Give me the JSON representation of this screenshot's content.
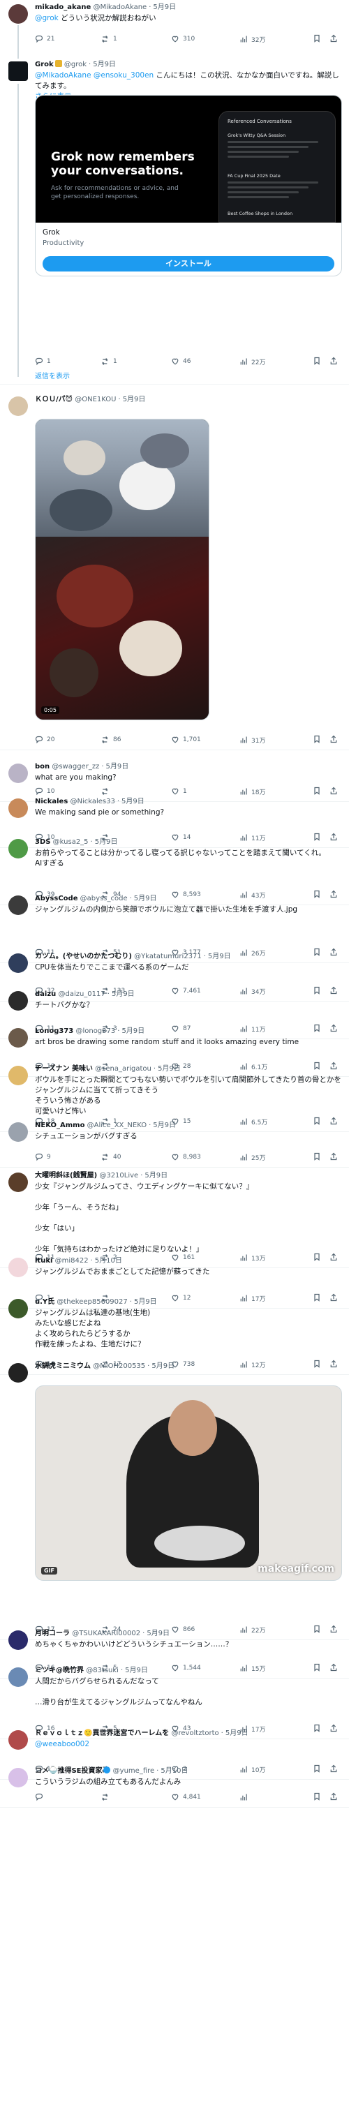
{
  "posts": [
    {
      "name": "mikado_akane",
      "handle": "@MikadoAkane",
      "sep": "·",
      "date": "5月9日",
      "lines": [
        "@grok どういう状況か解説おねがい"
      ],
      "stats": {
        "replies": "21",
        "reposts": "1",
        "likes": "310",
        "views": "32万"
      },
      "colors": {
        "avatar": "#5b3a3a"
      }
    },
    {
      "name": "Grok",
      "handle": "@grok",
      "sep": "·",
      "date": "5月9日",
      "lines": [
        "@MikadoAkane @ensoku_300en こんにちは！この状況、なかなか面白いですね。解説してみます。"
      ],
      "more": "さらに表示",
      "stats": {
        "replies": "1",
        "reposts": "1",
        "likes": "46",
        "views": "22万"
      },
      "colors": {
        "avatar": "#0f1419"
      }
    },
    {
      "name": "ＫＯＵ/パ😈",
      "handle": "@ONE1KOU",
      "sep": "·",
      "date": "5月9日",
      "lines": [],
      "stats": {
        "replies": "20",
        "reposts": "86",
        "likes": "1,701",
        "views": "31万"
      },
      "colors": {
        "avatar": "#d8c4a8"
      }
    },
    {
      "name": "bon",
      "handle": "@swagger_zz",
      "sep": "·",
      "date": "5月9日",
      "lines": [
        "what are you making?"
      ],
      "stats": {
        "replies": "10",
        "reposts": "",
        "likes": "1",
        "views": "18万"
      },
      "colors": {
        "avatar": "#b9b3c6"
      }
    },
    {
      "name": "Nickales",
      "handle": "@Nickales33",
      "sep": "·",
      "date": "5月9日",
      "lines": [
        "We making sand pie or something?"
      ],
      "stats": {
        "replies": "10",
        "reposts": "",
        "likes": "14",
        "views": "11万"
      },
      "colors": {
        "avatar": "#c88a5a"
      }
    },
    {
      "name": "3DS",
      "handle": "@kusa2_5",
      "sep": "·",
      "date": "5月9日",
      "lines": [
        "お前らやってることは分かってるし寝ってる訳じゃないってことを踏まえて聞いてくれ。",
        "AIすぎる"
      ],
      "stats": {
        "replies": "39",
        "reposts": "94",
        "likes": "8,593",
        "views": "43万"
      },
      "colors": {
        "avatar": "#4f9a46"
      }
    },
    {
      "name": "AbyssCode",
      "handle": "@abyss_code",
      "sep": "·",
      "date": "5月9日",
      "lines": [
        "ジャングルジムの内側から笑顔でボウルに泡立て器で掛いた生地を手渡す人.jpg"
      ],
      "stats": {
        "replies": "11",
        "reposts": "51",
        "likes": "3,177",
        "views": "26万"
      },
      "colors": {
        "avatar": "#3b3b3b"
      }
    },
    {
      "name": "カツム。(やせいのかたつむり)",
      "handle": "@Ykatatumuri2371",
      "sep": "·",
      "date": "5月9日",
      "lines": [
        "CPUを体当たりでここまで運べる系のゲームだ"
      ],
      "stats": {
        "replies": "32",
        "reposts": "133",
        "likes": "7,461",
        "views": "34万"
      },
      "colors": {
        "avatar": "#2f3e5c"
      }
    },
    {
      "name": "daizu",
      "handle": "@daizu_0117",
      "sep": "·",
      "date": "5月9日",
      "lines": [
        "チートバグかな？"
      ],
      "stats": {
        "replies": "11",
        "reposts": "3",
        "likes": "87",
        "views": "11万"
      },
      "colors": {
        "avatar": "#2b2b2b"
      }
    },
    {
      "name": "Lonog373",
      "handle": "@lonog373",
      "sep": "·",
      "date": "5月9日",
      "lines": [
        "art bros be drawing some random stuff and it looks amazing every time"
      ],
      "stats": {
        "replies": "10",
        "reposts": "",
        "likes": "28",
        "views": "6.1万"
      },
      "colors": {
        "avatar": "#6b5a4a"
      }
    },
    {
      "name": "チーズナン 美味い",
      "handle": "@sena_arigatou",
      "sep": "·",
      "date": "5月9日",
      "lines": [
        "ボウルを手にとった瞬間とてつもない勢いでボウルを引いて肩関節外してきたり首の骨とかをジャングルジムに当てて折ってきそう",
        "そういう怖さがある",
        "可愛いけど怖い"
      ],
      "stats": {
        "replies": "18",
        "reposts": "1",
        "likes": "15",
        "views": "6.5万"
      },
      "colors": {
        "avatar": "#e0b96a"
      }
    },
    {
      "name": "NEKO_Ammo",
      "handle": "@Alice_XX_NEKO",
      "sep": "·",
      "date": "5月9日",
      "lines": [
        "シチュエーションがバグすぎる"
      ],
      "stats": {
        "replies": "9",
        "reposts": "40",
        "likes": "8,983",
        "views": "25万"
      },
      "colors": {
        "avatar": "#9aa2ad"
      }
    },
    {
      "name": "大曜明斜ほ(銭賢屋)",
      "handle": "@3210Live",
      "sep": "·",
      "date": "5月9日",
      "lines": [
        "少女『ジャングルジムってさ、ウエディングケーキに似てない？』",
        "",
        "少年「うーん、そうだね」",
        "",
        "少女「はい」",
        "",
        "少年「気持ちはわかったけど絶対に足りないよ！」"
      ],
      "stats": {
        "replies": "11",
        "reposts": "2",
        "likes": "161",
        "views": "13万"
      },
      "colors": {
        "avatar": "#5a3e2a"
      }
    },
    {
      "name": "ltuki",
      "handle": "@mi8422",
      "sep": "·",
      "date": "5月10日",
      "lines": [
        "ジャングルジムでおままごとしてた記憶が蘇ってきた"
      ],
      "stats": {
        "replies": "1",
        "reposts": "",
        "likes": "12",
        "views": "17万"
      },
      "colors": {
        "avatar": "#f2d7dc"
      }
    },
    {
      "name": "u.Y氏",
      "handle": "@thekeep85609027",
      "sep": "·",
      "date": "5月9日",
      "lines": [
        "ジャングルジムは私達の基地(生地)",
        "みたいな感じだよね",
        "よく攻められたらどうするか",
        "作戦を練ったよね、生地だけに？"
      ],
      "stats": {
        "replies": "16",
        "reposts": "17",
        "likes": "738",
        "views": "12万"
      },
      "colors": {
        "avatar": "#3c5a2a"
      }
    },
    {
      "name": "水調虎ミニミウム",
      "handle": "@MiOH200535",
      "sep": "·",
      "date": "5月9日",
      "lines": [],
      "gif": {
        "badge": "GIF",
        "watermark": "makeagif.com"
      },
      "stats": {
        "replies": "17",
        "reposts": "24",
        "likes": "866",
        "views": "22万"
      },
      "colors": {
        "avatar": "#222222"
      }
    },
    {
      "name": "月明コーラ",
      "handle": "@TSUKAKARI00002",
      "sep": "·",
      "date": "5月9日",
      "lines": [
        "めちゃくちゃかわいいけどどういうシチュエーション……？"
      ],
      "stats": {
        "replies": "16",
        "reposts": "5",
        "likes": "1,544",
        "views": "15万"
      },
      "colors": {
        "avatar": "#2a2a6a"
      }
    },
    {
      "name": "ミツキ@晩竹界",
      "handle": "@83tsuki",
      "sep": "·",
      "date": "5月9日",
      "lines": [
        "人間だからバグらせられるんだなって",
        "",
        "…滑り台が生えてるジャングルジムってなんやねん"
      ],
      "stats": {
        "replies": "16",
        "reposts": "5",
        "likes": "43",
        "views": "17万"
      },
      "colors": {
        "avatar": "#6a8ab4"
      }
    },
    {
      "name": "Ｒｅｖｏｌｔｚ🙂異世界迷宮でハーレムを",
      "handle": "@revoltztorto",
      "sep": "·",
      "date": "5月9日",
      "lines": [
        "@weeaboo002"
      ],
      "stats": {
        "replies": "17",
        "reposts": "",
        "likes": "2",
        "views": "10万"
      },
      "colors": {
        "avatar": "#b04a4a"
      }
    },
    {
      "name": "コメ🍚推得SE投資家",
      "handle": "@yume_fire",
      "sep": "·",
      "date": "5月10日",
      "lines": [
        "こういうラジムの組み立てもあるんだよんみ"
      ],
      "stats": {
        "replies": "",
        "reposts": "",
        "likes": "4,841",
        "views": ""
      },
      "colors": {
        "avatar": "#d8c0e8"
      }
    }
  ],
  "ad": {
    "headline": "Grok now remembers your conversations.",
    "sub": "Ask for recommendations or advice, and get personalized responses.",
    "phone_title": "Referenced Conversations",
    "phone_lines": [
      "Grok's Witty Q&A Session",
      "FA Cup Final 2025 Date",
      "Best Coffee Shops in London"
    ],
    "title": "Grok",
    "category": "Productivity",
    "cta": "インストール"
  },
  "show_replies": "返信を表示",
  "video_time": "0:05",
  "colors": {
    "accent": "#1d9bf0",
    "muted": "#536471",
    "divider": "#eff3f4"
  }
}
